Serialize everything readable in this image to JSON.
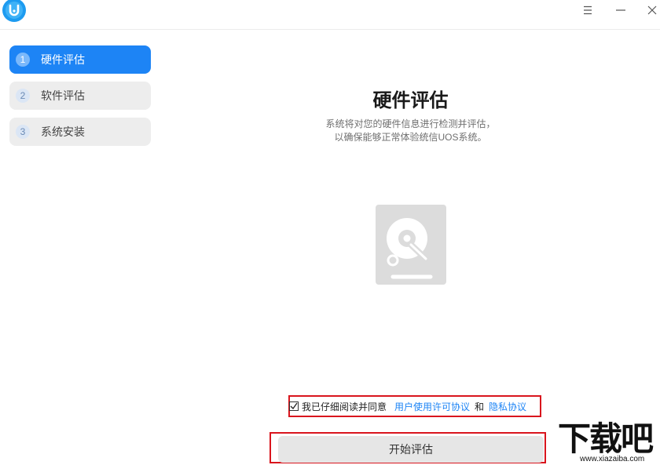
{
  "titlebar": {
    "logo_icon": "uos-logo-icon",
    "menu_icon": "menu-icon",
    "minimize_icon": "minimize-icon",
    "close_icon": "close-icon"
  },
  "sidebar": {
    "steps": [
      {
        "num": "1",
        "label": "硬件评估",
        "active": true
      },
      {
        "num": "2",
        "label": "软件评估",
        "active": false
      },
      {
        "num": "3",
        "label": "系统安装",
        "active": false
      }
    ]
  },
  "main": {
    "title": "硬件评估",
    "desc_line1": "系统将对您的硬件信息进行检测并评估，",
    "desc_line2": "以确保能够正常体验统信UOS系统。",
    "illustration_icon": "hard-disk-icon"
  },
  "agreement": {
    "checked": true,
    "prefix": "我已仔细阅读并同意",
    "license_link": "用户使用许可协议",
    "and": "和",
    "privacy_link": "隐私协议"
  },
  "start_button": {
    "label": "开始评估"
  },
  "watermark": {
    "text": "下载吧",
    "url": "www.xiazaiba.com"
  },
  "colors": {
    "accent": "#1d84f5",
    "highlight_box": "#d9151d",
    "step_inactive_bg": "#ededed"
  }
}
